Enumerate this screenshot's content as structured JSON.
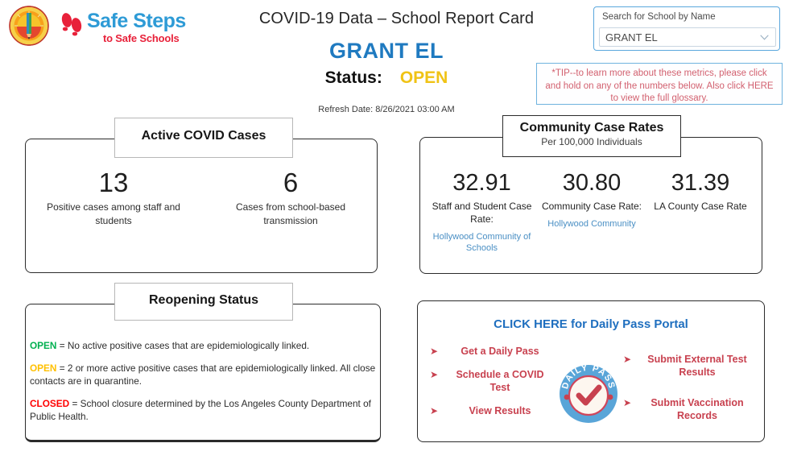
{
  "header": {
    "title": "COVID-19 Data – School Report Card",
    "school_name": "GRANT EL",
    "status_label": "Status:",
    "status_value": "OPEN",
    "status_color": "#f0c315",
    "refresh_date": "Refresh Date: 8/26/2021 03:00 AM",
    "logo_primary": "Safe Steps",
    "logo_secondary": "to Safe Schools",
    "seal_icon": "lausd-seal-icon"
  },
  "search": {
    "label": "Search for School by Name",
    "value": "GRANT EL",
    "dropdown_icon": "chevron-down-icon"
  },
  "tip": {
    "text": "*TIP--to learn more about these metrics, please click and hold on any of the numbers below. Also click HERE to view the full glossary.",
    "color": "#d2606f"
  },
  "active_cases": {
    "header": "Active COVID Cases",
    "metrics": [
      {
        "value": "13",
        "caption": "Positive cases among staff and students"
      },
      {
        "value": "6",
        "caption": "Cases from school-based transmission"
      }
    ]
  },
  "community_rates": {
    "header": "Community Case Rates",
    "subheader": "Per 100,000 Individuals",
    "rates": [
      {
        "value": "32.91",
        "caption": "Staff and Student Case Rate:",
        "link": "Hollywood Community of Schools"
      },
      {
        "value": "30.80",
        "caption": "Community Case Rate:",
        "link": "Hollywood Community"
      },
      {
        "value": "31.39",
        "caption": "LA County Case Rate",
        "link": ""
      }
    ]
  },
  "reopening": {
    "header": "Reopening Status",
    "rules": [
      {
        "keyword": "OPEN",
        "color": "#00b050",
        "text": " = No active positive cases that are epidemiologically linked."
      },
      {
        "keyword": "OPEN",
        "color": "#ffc000",
        "text": " = 2 or more active positive cases that are epidemiologically linked.  All close contacts are in quarantine."
      },
      {
        "keyword": "CLOSED",
        "color": "#ff0000",
        "text": " = School closure determined by the Los Angeles County Department of Public Health."
      }
    ]
  },
  "daily_pass": {
    "title": "CLICK HERE for Daily Pass Portal",
    "title_color": "#1f6fbf",
    "link_color": "#c8414f",
    "badge_text_top": "DAILY",
    "badge_text_bottom": "PASS",
    "badge_icon": "daily-pass-check-badge-icon",
    "left_links": [
      "Get a Daily Pass",
      "Schedule a COVID Test",
      "View Results"
    ],
    "right_links": [
      "Submit External Test Results",
      "Submit Vaccination Records"
    ],
    "arrow_icon": "arrow-bullet-icon"
  }
}
